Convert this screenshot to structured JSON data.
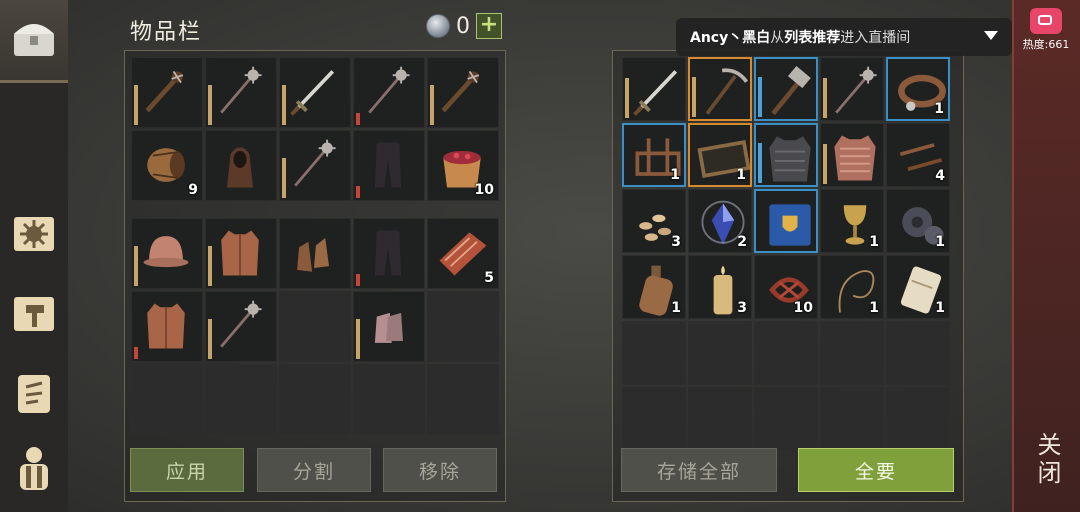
{
  "inventory": {
    "title": "物品栏",
    "currency_value": "0",
    "buttons": {
      "apply": "应用",
      "split": "分割",
      "remove": "移除"
    },
    "cells": [
      {
        "icon": "spiked-club-icon",
        "qty": "",
        "bar": "yes"
      },
      {
        "icon": "mace-icon",
        "qty": "",
        "bar": "yes"
      },
      {
        "icon": "sword-icon",
        "qty": "",
        "bar": "yes"
      },
      {
        "icon": "mace-icon",
        "qty": "",
        "bar": "red"
      },
      {
        "icon": "spiked-club-icon",
        "qty": "",
        "bar": "yes"
      },
      {
        "icon": "barrel-icon",
        "qty": "9",
        "bar": ""
      },
      {
        "icon": "hood-icon",
        "qty": "",
        "bar": ""
      },
      {
        "icon": "mace-icon",
        "qty": "",
        "bar": "yes"
      },
      {
        "icon": "trousers-icon",
        "qty": "",
        "bar": "red"
      },
      {
        "icon": "berry-bucket-icon",
        "qty": "10",
        "bar": ""
      }
    ],
    "equip_cells": [
      {
        "icon": "helmet-icon",
        "qty": "",
        "bar": "yes"
      },
      {
        "icon": "gambeson-icon",
        "qty": "",
        "bar": "yes"
      },
      {
        "icon": "gloves-icon",
        "qty": "",
        "bar": ""
      },
      {
        "icon": "trousers-icon",
        "qty": "",
        "bar": "red"
      },
      {
        "icon": "meat-icon",
        "qty": "5",
        "bar": ""
      },
      {
        "icon": "gambeson-icon",
        "qty": "",
        "bar": "red"
      },
      {
        "icon": "mace-icon",
        "qty": "",
        "bar": "yes"
      },
      {
        "icon": "",
        "qty": "",
        "bar": ""
      },
      {
        "icon": "chainmail-gloves-icon",
        "qty": "",
        "bar": "yes"
      },
      {
        "icon": "",
        "qty": "",
        "bar": ""
      }
    ]
  },
  "storage": {
    "buttons": {
      "store_all": "存储全部",
      "take_all": "全要"
    },
    "cells": [
      {
        "icon": "sword-icon",
        "qty": "",
        "bar": "yes",
        "rarity": ""
      },
      {
        "icon": "pickaxe-icon",
        "qty": "",
        "bar": "yes",
        "rarity": "orange"
      },
      {
        "icon": "hammer-icon",
        "qty": "",
        "bar": "blue",
        "rarity": "blue"
      },
      {
        "icon": "mace-icon",
        "qty": "",
        "bar": "yes",
        "rarity": ""
      },
      {
        "icon": "collar-icon",
        "qty": "1",
        "bar": "",
        "rarity": "blue"
      },
      {
        "icon": "rack-icon",
        "qty": "1",
        "bar": "",
        "rarity": "blue"
      },
      {
        "icon": "tray-icon",
        "qty": "1",
        "bar": "",
        "rarity": "orange"
      },
      {
        "icon": "armor-icon",
        "qty": "",
        "bar": "blue",
        "rarity": "blue"
      },
      {
        "icon": "chainmail-shirt-icon",
        "qty": "",
        "bar": "yes",
        "rarity": ""
      },
      {
        "icon": "nails-icon",
        "qty": "4",
        "bar": "",
        "rarity": ""
      },
      {
        "icon": "seeds-icon",
        "qty": "3",
        "bar": "",
        "rarity": ""
      },
      {
        "icon": "crystal-icon",
        "qty": "2",
        "bar": "",
        "rarity": ""
      },
      {
        "icon": "book-icon",
        "qty": "",
        "bar": "",
        "rarity": "blue"
      },
      {
        "icon": "goblet-icon",
        "qty": "1",
        "bar": "",
        "rarity": ""
      },
      {
        "icon": "gears-icon",
        "qty": "1",
        "bar": "",
        "rarity": ""
      },
      {
        "icon": "bottle-icon",
        "qty": "1",
        "bar": "",
        "rarity": ""
      },
      {
        "icon": "candle-icon",
        "qty": "3",
        "bar": "",
        "rarity": ""
      },
      {
        "icon": "rope-icon",
        "qty": "10",
        "bar": "",
        "rarity": ""
      },
      {
        "icon": "whip-icon",
        "qty": "1",
        "bar": "",
        "rarity": ""
      },
      {
        "icon": "scroll-icon",
        "qty": "1",
        "bar": "",
        "rarity": ""
      }
    ]
  },
  "stream_notice": {
    "user": "Ancy丶黑白",
    "from": " 从 ",
    "source": "列表推荐",
    "action": " 进入直播间"
  },
  "heat_label": "热度:661",
  "close_label": "关闭",
  "colors": {
    "accent_green": "#80a03c",
    "bar_gold": "#c6a46a",
    "bar_red": "#c4463a",
    "rarity_blue": "#3a8fc8",
    "rarity_orange": "#d88a2e"
  }
}
